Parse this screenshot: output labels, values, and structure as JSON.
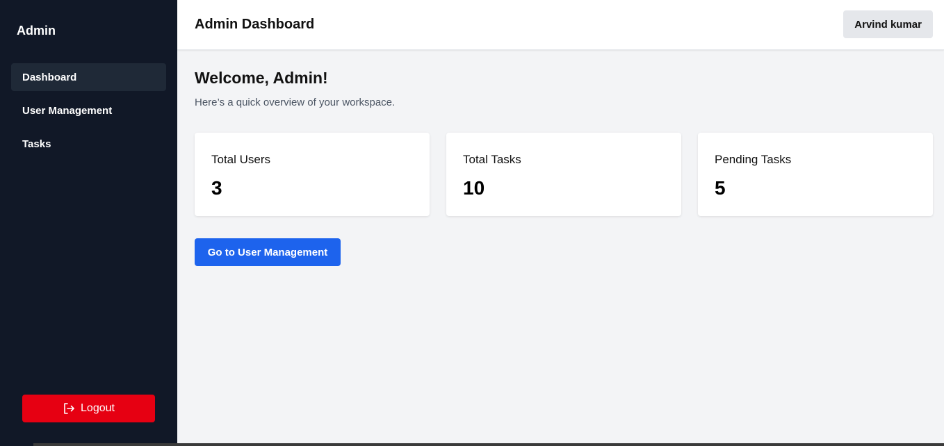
{
  "sidebar": {
    "brand": "Admin",
    "items": [
      {
        "label": "Dashboard",
        "active": true
      },
      {
        "label": "User Management",
        "active": false
      },
      {
        "label": "Tasks",
        "active": false
      }
    ],
    "logout_label": "Logout",
    "logout_icon": "logout-icon"
  },
  "header": {
    "title": "Admin Dashboard",
    "user_name": "Arvind kumar"
  },
  "main": {
    "welcome": "Welcome, Admin!",
    "subtitle": "Here’s a quick overview of your workspace.",
    "cards": [
      {
        "label": "Total Users",
        "value": "3"
      },
      {
        "label": "Total Tasks",
        "value": "10"
      },
      {
        "label": "Pending Tasks",
        "value": "5"
      }
    ],
    "primary_button": "Go to User Management"
  },
  "colors": {
    "sidebar_bg": "#111827",
    "active_item_bg": "#1f2937",
    "logout_bg": "#e60012",
    "primary_bg": "#1d63ed",
    "page_bg": "#f3f4f6"
  }
}
